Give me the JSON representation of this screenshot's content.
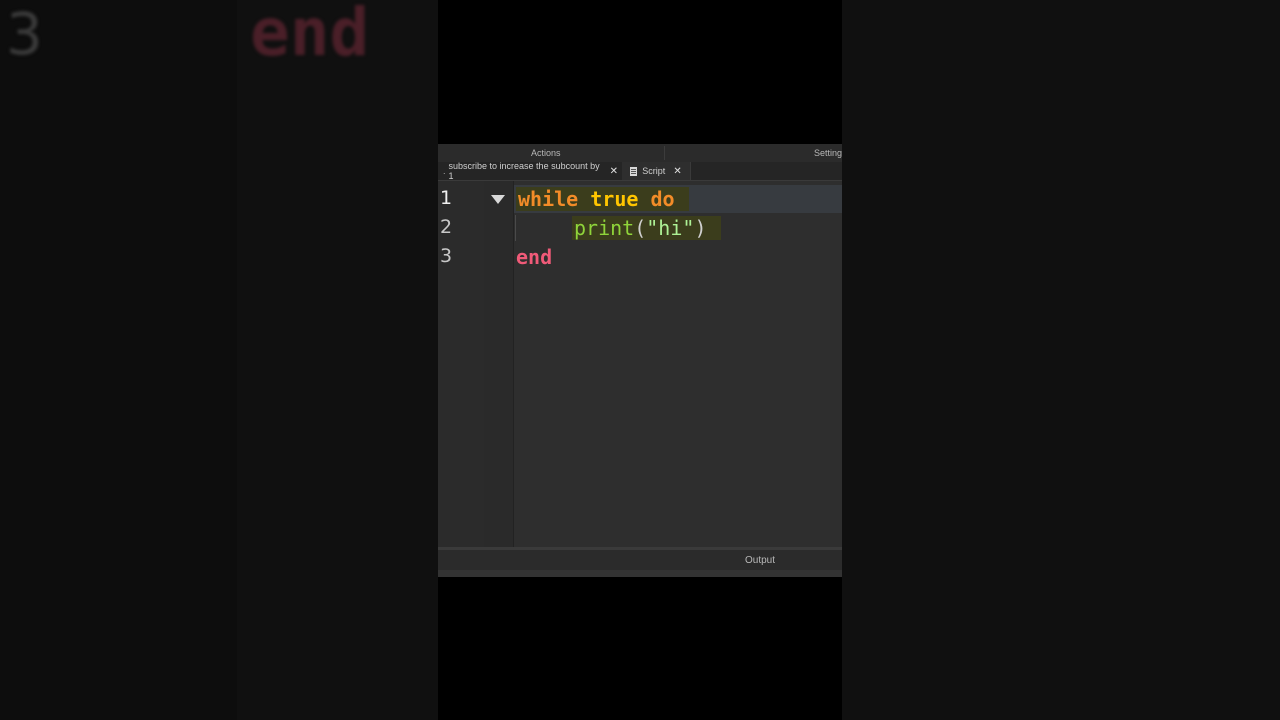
{
  "background": {
    "ghost_line_number": "3",
    "ghost_keyword": "end"
  },
  "ribbon": {
    "actions_label": "Actions",
    "settings_label": "Setting"
  },
  "tabs": [
    {
      "label": "subscribe to increase the subcount by 1",
      "close": "✕",
      "prefix": "."
    },
    {
      "label": "Script",
      "close": "✕",
      "icon": "script-doc-icon"
    }
  ],
  "editor": {
    "line_numbers": [
      "1",
      "2",
      "3"
    ],
    "line1": {
      "kw1": "while",
      "bool": "true",
      "kw2": "do"
    },
    "line2": {
      "fn": "print",
      "open": "(",
      "str": "\"hi\"",
      "close": ")"
    },
    "line3": {
      "kw": "end"
    }
  },
  "colors": {
    "keyword": "#f28c28",
    "boolean": "#ffc600",
    "builtin": "#8fd43a",
    "string": "#adf195",
    "end_keyword": "#f05a78"
  },
  "output": {
    "label": "Output"
  }
}
